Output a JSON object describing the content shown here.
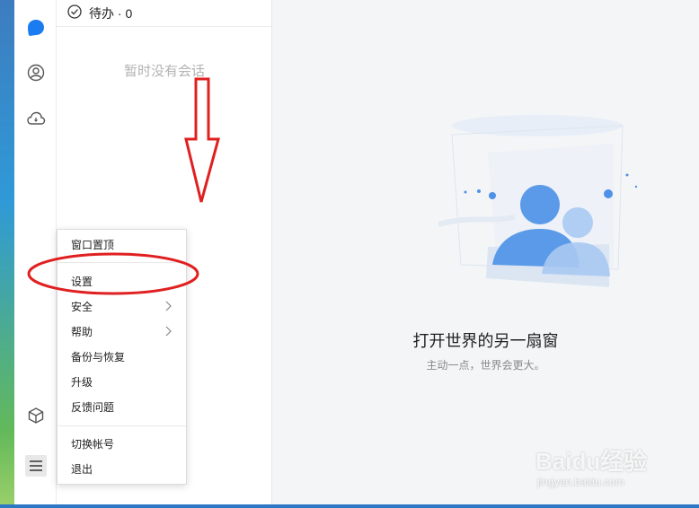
{
  "todo": {
    "label": "待办 · 0"
  },
  "session": {
    "empty_text": "暂时没有会话"
  },
  "main": {
    "title": "打开世界的另一扇窗",
    "subtitle": "主动一点，世界会更大。"
  },
  "menu": {
    "items": [
      {
        "label": "窗口置顶"
      },
      {
        "label": "设置"
      },
      {
        "label": "安全"
      },
      {
        "label": "帮助"
      },
      {
        "label": "备份与恢复"
      },
      {
        "label": "升级"
      },
      {
        "label": "反馈问题"
      },
      {
        "label": "切换帐号"
      },
      {
        "label": "退出"
      }
    ]
  },
  "rail": {
    "icons": [
      "chat-icon",
      "contacts-icon",
      "cloud-icon",
      "app-box-icon",
      "menu-icon"
    ]
  },
  "watermark": {
    "brand": "Baidu经验",
    "url": "jingyan.baidu.com"
  },
  "colors": {
    "accent": "#1a7cf0",
    "annotation": "#e02020"
  }
}
